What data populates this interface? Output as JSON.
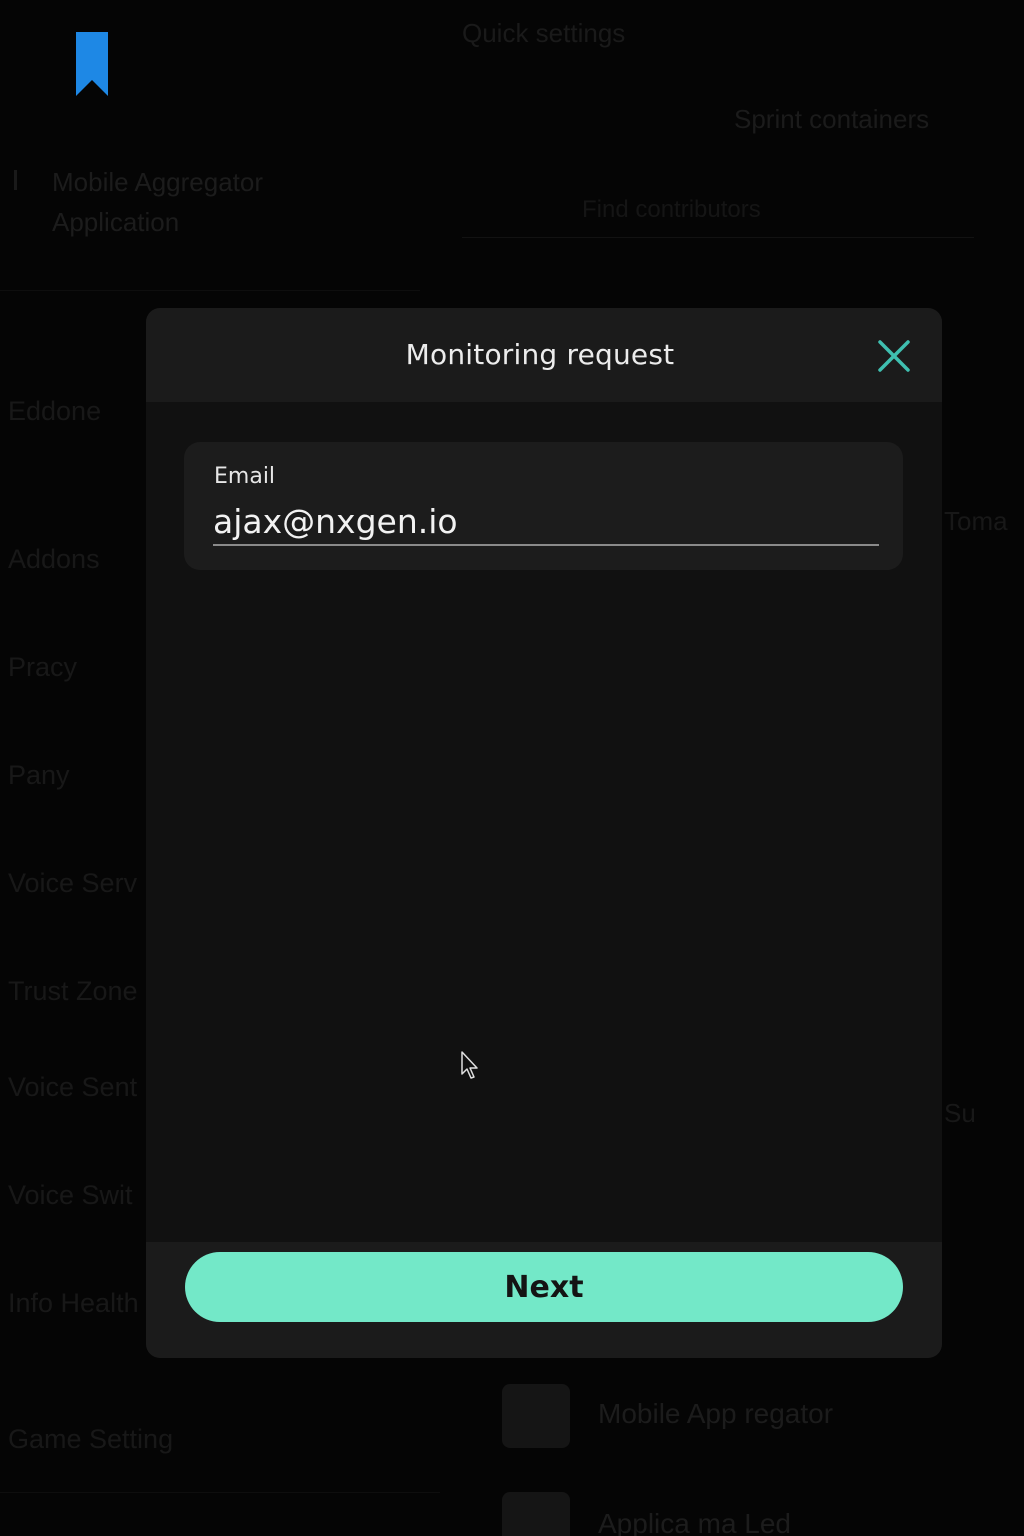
{
  "background": {
    "app_title": "Quick settings",
    "right_heading": "Sprint containers",
    "app_name_lines": [
      "Mobile Aggregator",
      "Application"
    ],
    "search_hint": "Find contributors",
    "left_rows": [
      "Eddone",
      "Addons",
      "Pracy",
      "Pany",
      "Voice Serv",
      "Trust Zone",
      "Voice Sent",
      "Voice Swit",
      "Info Health",
      "Game Setting"
    ],
    "right_rows": [
      "Toma",
      "Su"
    ],
    "list_items": [
      "Mobile App regator",
      "Applica ma Led"
    ]
  },
  "modal": {
    "title": "Monitoring request",
    "email": {
      "label": "Email",
      "value": "ajax@nxgen.io"
    },
    "next_label": "Next"
  },
  "colors": {
    "accent": "#73e8c8",
    "close_icon": "#3fbfb0",
    "bookmark": "#1e88e5"
  },
  "icons": {
    "close": "close-icon",
    "bookmark": "bookmark-icon",
    "cursor": "mouse-cursor-icon"
  }
}
